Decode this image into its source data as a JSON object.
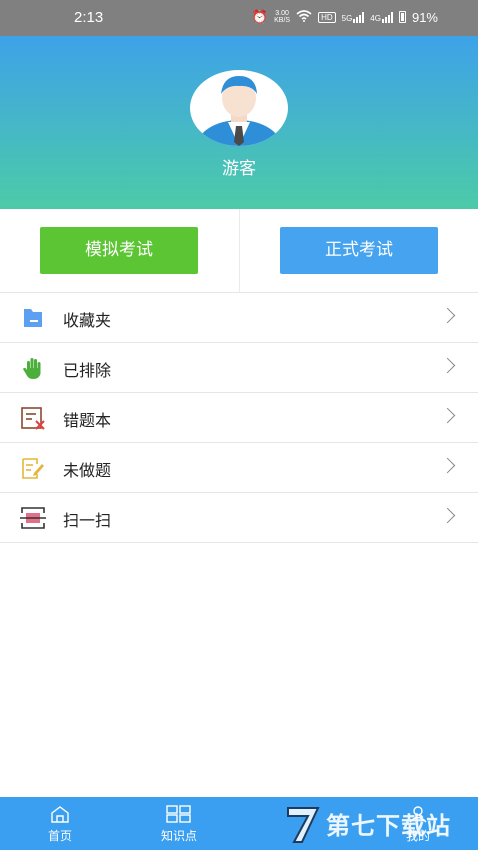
{
  "status_bar": {
    "time": "2:13",
    "net_speed_value": "3.00",
    "net_speed_unit": "KB/S",
    "hd_label": "HD",
    "sim1_label": "5G",
    "sim2_label": "4G",
    "battery": "91%"
  },
  "profile": {
    "username": "游客"
  },
  "actions": {
    "mock_exam": "模拟考试",
    "formal_exam": "正式考试"
  },
  "menu": {
    "items": [
      {
        "label": "收藏夹",
        "icon": "folder-icon"
      },
      {
        "label": "已排除",
        "icon": "hand-icon"
      },
      {
        "label": "错题本",
        "icon": "wrong-note-icon"
      },
      {
        "label": "未做题",
        "icon": "edit-note-icon"
      },
      {
        "label": "扫一扫",
        "icon": "scan-icon"
      }
    ]
  },
  "bottom_nav": {
    "items": [
      {
        "label": "首页",
        "icon": "home-icon"
      },
      {
        "label": "知识点",
        "icon": "grid-icon"
      },
      {
        "label": "我的",
        "icon": "user-icon"
      }
    ]
  },
  "colors": {
    "header_top": "#3ea2e8",
    "header_bottom": "#4ccba8",
    "mock_button": "#5cc534",
    "formal_button": "#46a3ef",
    "nav_background": "#3a9ff0"
  },
  "watermark": {
    "text": "第七下载站"
  }
}
